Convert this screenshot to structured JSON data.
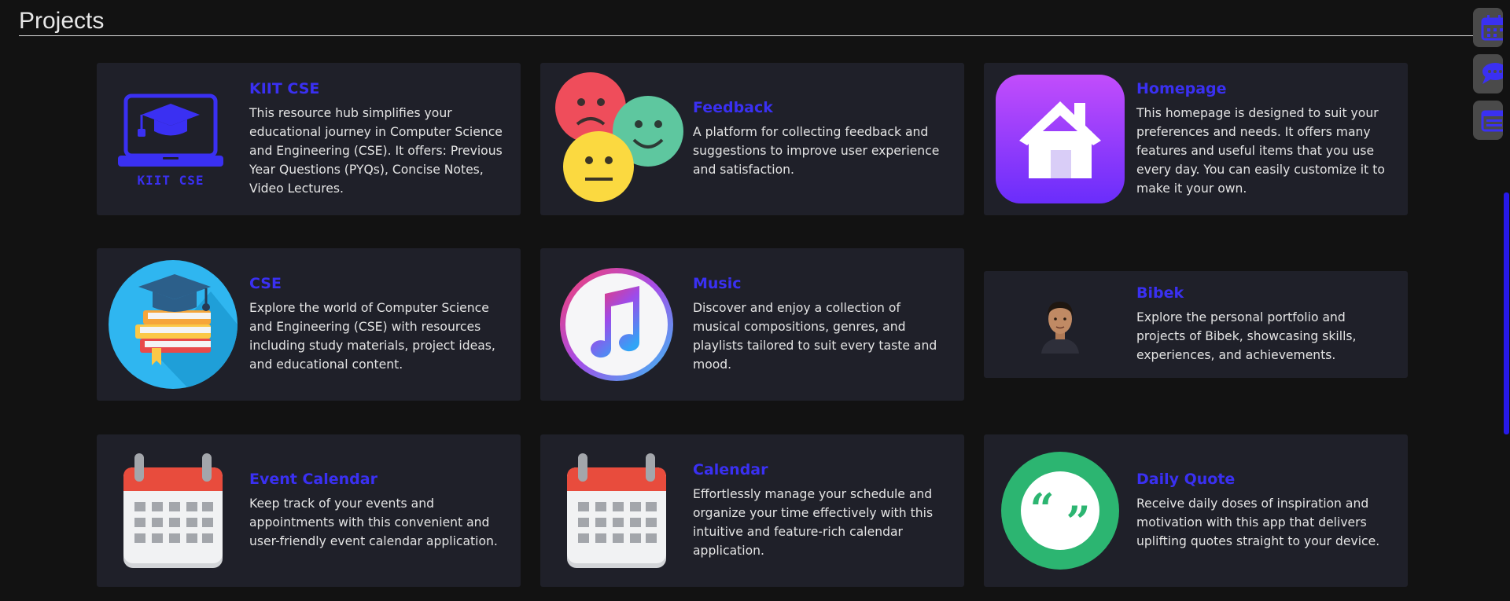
{
  "page": {
    "title": "Projects"
  },
  "colors": {
    "background": "#121212",
    "card": "#1f2029",
    "accent": "#3a30f2",
    "text": "#e4e4e4"
  },
  "projects": [
    {
      "title": "KIIT CSE",
      "description": "This resource hub simplifies your educational journey in Computer Science and Engineering (CSE). It offers: Previous Year Questions (PYQs), Concise Notes, Video Lectures.",
      "icon": "laptop-graduation-cap-icon",
      "icon_caption": "KIIT CSE"
    },
    {
      "title": "Feedback",
      "description": "A platform for collecting feedback and suggestions to improve user experience and satisfaction.",
      "icon": "feedback-emoji-faces-icon"
    },
    {
      "title": "Homepage",
      "description": "This homepage is designed to suit your preferences and needs. It offers many features and useful items that you use every day. You can easily customize it to make it your own.",
      "icon": "house-icon"
    },
    {
      "title": "CSE",
      "description": "Explore the world of Computer Science and Engineering (CSE) with resources including study materials, project ideas, and educational content.",
      "icon": "books-graduation-cap-icon"
    },
    {
      "title": "Music",
      "description": "Discover and enjoy a collection of musical compositions, genres, and playlists tailored to suit every taste and mood.",
      "icon": "music-note-icon"
    },
    {
      "title": "Bibek",
      "description": "Explore the personal portfolio and projects of Bibek, showcasing skills, experiences, and achievements.",
      "icon": "profile-photo-avatar"
    },
    {
      "title": "Event Calendar",
      "description": "Keep track of your events and appointments with this convenient and user-friendly event calendar application.",
      "icon": "calendar-icon"
    },
    {
      "title": "Calendar",
      "description": "Effortlessly manage your schedule and organize your time effectively with this intuitive and feature-rich calendar application.",
      "icon": "calendar-icon"
    },
    {
      "title": "Daily Quote",
      "description": "Receive daily doses of inspiration and motivation with this app that delivers uplifting quotes straight to your device.",
      "icon": "quote-marks-icon"
    }
  ],
  "side_buttons": [
    {
      "icon": "calendar-shortcut-icon"
    },
    {
      "icon": "chat-shortcut-icon"
    },
    {
      "icon": "newspaper-shortcut-icon"
    }
  ]
}
